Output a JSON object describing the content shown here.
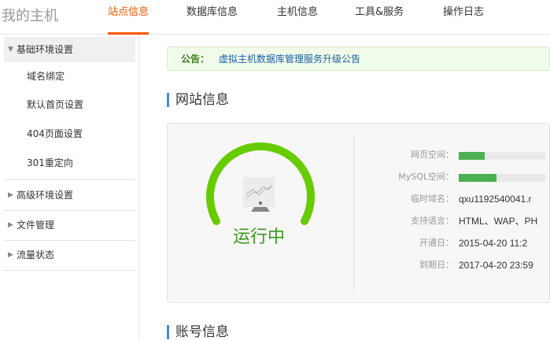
{
  "header": {
    "logo": "我的主机",
    "tabs": [
      {
        "label": "站点信息",
        "active": true
      },
      {
        "label": "数据库信息"
      },
      {
        "label": "主机信息"
      },
      {
        "label": "工具&服务"
      },
      {
        "label": "操作日志"
      }
    ]
  },
  "sidebar": {
    "groups": [
      {
        "label": "基础环境设置",
        "expanded": true,
        "items": [
          "域名绑定",
          "默认首页设置",
          "404页面设置",
          "301重定向"
        ]
      },
      {
        "label": "高级环境设置"
      },
      {
        "label": "文件管理"
      },
      {
        "label": "流量状态"
      }
    ]
  },
  "notice": {
    "label": "公告：",
    "link": "虚拟主机数据库管理服务升级公告"
  },
  "site": {
    "title": "网站信息",
    "status": "运行中",
    "status_color": "#66cc00",
    "fields": [
      {
        "label": "网页空间：",
        "usage": 0.3
      },
      {
        "label": "MySQL空间：",
        "usage": 0.44
      },
      {
        "label": "临时域名：",
        "value": "qxu1192540041.r"
      },
      {
        "label": "支持语言：",
        "value": "HTML、WAP、PH"
      },
      {
        "label": "开通日：",
        "value": "2015-04-20 11:2"
      },
      {
        "label": "到期日：",
        "value": "2017-04-20 23:59"
      }
    ]
  },
  "account": {
    "title": "账号信息"
  }
}
